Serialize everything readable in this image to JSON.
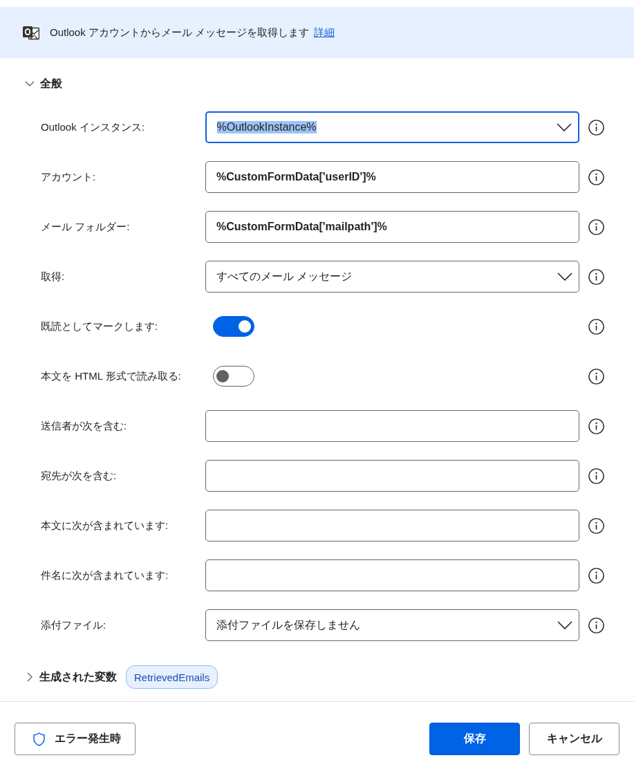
{
  "header": {
    "description": "Outlook アカウントからメール メッセージを取得します",
    "link": "詳細"
  },
  "general": {
    "title": "全般",
    "expanded": true,
    "fields": [
      {
        "kind": "dropdown",
        "label": "Outlook インスタンス:",
        "value": "%OutlookInstance%",
        "focused": true
      },
      {
        "kind": "text",
        "label": "アカウント:",
        "value": "%CustomFormData['userID']%",
        "focused": false
      },
      {
        "kind": "text",
        "label": "メール フォルダー:",
        "value": "%CustomFormData['mailpath']%",
        "focused": false
      },
      {
        "kind": "dropdown",
        "label": "取得:",
        "value": "すべてのメール メッセージ",
        "focused": false
      },
      {
        "kind": "toggle",
        "label": "既読としてマークします:",
        "on": true
      },
      {
        "kind": "toggle",
        "label": "本文を HTML 形式で読み取る:",
        "on": false
      },
      {
        "kind": "text",
        "label": "送信者が次を含む:",
        "focused": false
      },
      {
        "kind": "text",
        "label": "宛先が次を含む:",
        "focused": false
      },
      {
        "kind": "text",
        "label": "本文に次が含まれています:",
        "focused": false
      },
      {
        "kind": "text",
        "label": "件名に次が含まれています:",
        "focused": false
      },
      {
        "kind": "dropdown",
        "label": "添付ファイル:",
        "value": "添付ファイルを保存しません",
        "focused": false
      }
    ]
  },
  "generated_variables": {
    "title": "生成された変数",
    "expanded": false,
    "variables": [
      "RetrievedEmails"
    ]
  },
  "buttons": [
    {
      "kind": "on-error",
      "label": "エラー発生時"
    },
    {
      "kind": "primary",
      "label": "保存"
    },
    {
      "kind": "secondary",
      "label": "キャンセル"
    }
  ]
}
